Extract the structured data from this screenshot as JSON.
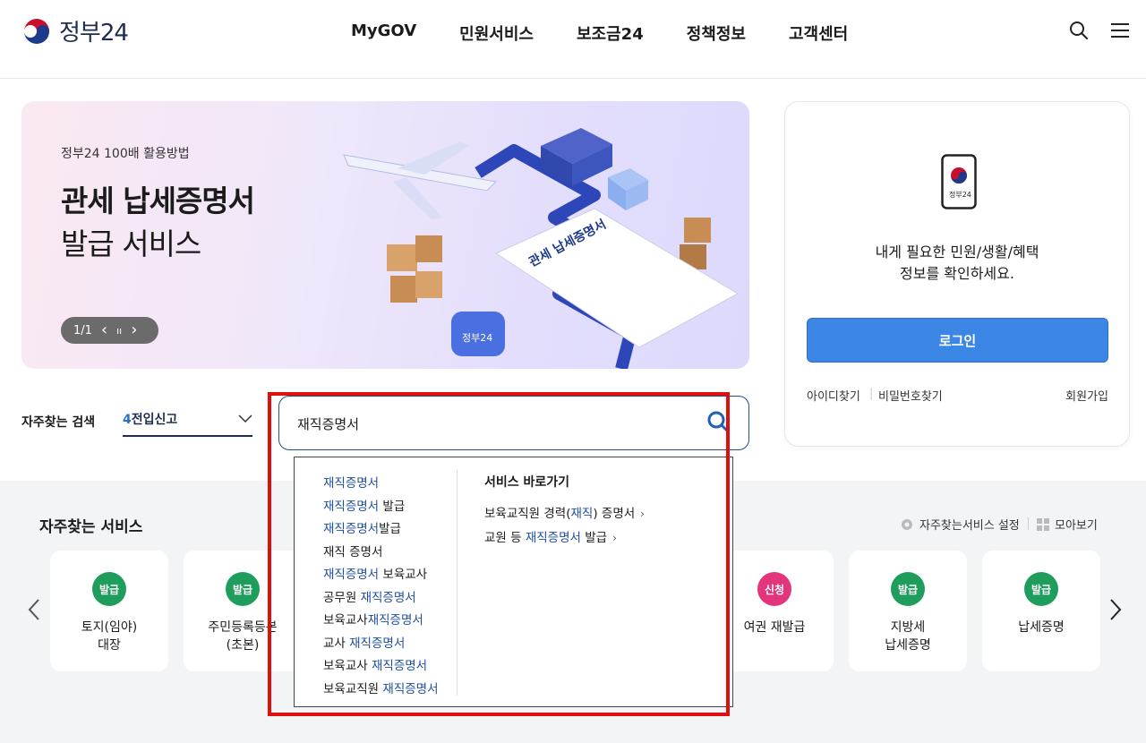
{
  "header": {
    "logo_text": "정부24",
    "nav": [
      "MyGOV",
      "민원서비스",
      "보조금24",
      "정책정보",
      "고객센터"
    ],
    "icons": [
      "search-icon",
      "menu-icon"
    ]
  },
  "banner": {
    "subtitle": "정부24 100배 활용방법",
    "title_line1": "관세 납세증명서",
    "title_line2": "발급 서비스",
    "counter": "1/1",
    "prev": "‹",
    "pause": "ıı",
    "next": "›",
    "doc_label": "관세 납세증명서",
    "badge_label": "정부24"
  },
  "login": {
    "phone_label": "정부24",
    "msg_line1": "내게 필요한 민원/생활/혜택",
    "msg_line2": "정보를 확인하세요.",
    "button": "로그인",
    "find_id": "아이디찾기",
    "find_pw": "비밀번호찾기",
    "signup": "회원가입"
  },
  "frequent_search": {
    "label": "자주찾는 검색",
    "selected_num": "4",
    "selected_text": "전입신고"
  },
  "search": {
    "value": "재직증명서"
  },
  "dropdown": {
    "suggestions": [
      {
        "pre": "",
        "hl": "재직증명서",
        "post": ""
      },
      {
        "pre": "",
        "hl": "재직증명서",
        "post": " 발급"
      },
      {
        "pre": "",
        "hl": "재직증명서",
        "post": "발급"
      },
      {
        "pre": "재직 증명서",
        "hl": "",
        "post": ""
      },
      {
        "pre": "",
        "hl": "재직증명서",
        "post": " 보육교사"
      },
      {
        "pre": "공무원 ",
        "hl": "재직증명서",
        "post": ""
      },
      {
        "pre": "보육교사",
        "hl": "재직증명서",
        "post": ""
      },
      {
        "pre": "교사 ",
        "hl": "재직증명서",
        "post": ""
      },
      {
        "pre": "보육교사 ",
        "hl": "재직증명서",
        "post": ""
      },
      {
        "pre": "보육교직원 ",
        "hl": "재직증명서",
        "post": ""
      }
    ],
    "shortcut_title": "서비스 바로가기",
    "shortcuts": [
      {
        "pre": "보육교직원 경력(",
        "hl": "재직",
        "post": ") 증명서"
      },
      {
        "pre": "교원 등 ",
        "hl": "재직증명서",
        "post": " 발급"
      }
    ]
  },
  "services": {
    "title": "자주찾는 서비스",
    "setting": "자주찾는서비스 설정",
    "view_all": "모아보기",
    "cards": [
      {
        "badge": "발급",
        "badge_color": "#1f9d5c",
        "label": "토지(임야)\n대장"
      },
      {
        "badge": "발급",
        "badge_color": "#1f9d5c",
        "label": "주민등록등본\n(초본)"
      },
      {
        "badge": "신청",
        "badge_color": "#e2357c",
        "label": "여권 재발급"
      },
      {
        "badge": "발급",
        "badge_color": "#1f9d5c",
        "label": "지방세\n납세증명"
      },
      {
        "badge": "발급",
        "badge_color": "#1f9d5c",
        "label": "납세증명"
      }
    ]
  },
  "colors": {
    "primary": "#3c87e6",
    "navy": "#1e2c4f",
    "highlight": "#1d4f9a",
    "frame": "#e00f0f"
  }
}
